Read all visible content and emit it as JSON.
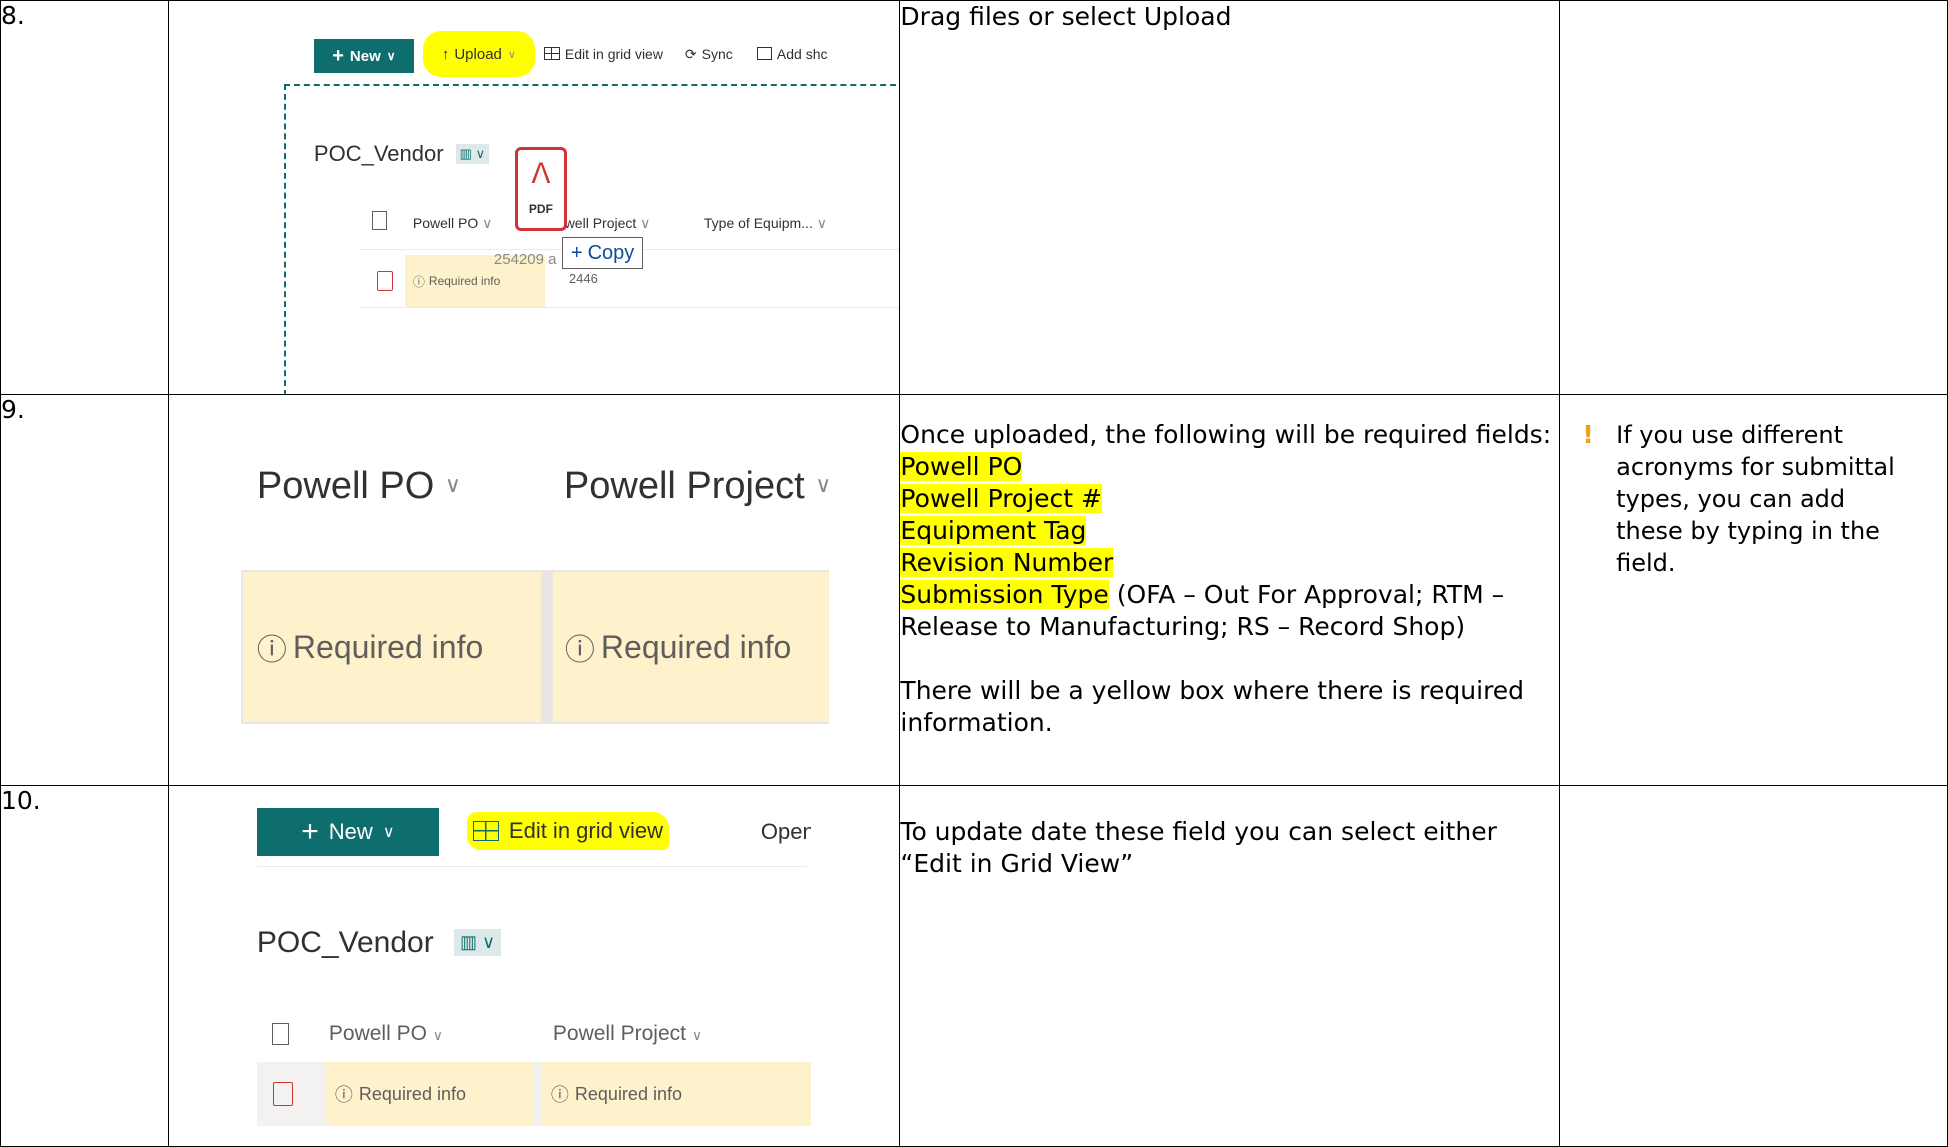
{
  "rows": [
    {
      "number": "8.",
      "description": "Drag files or select Upload",
      "note": "",
      "screenshot": {
        "new_label": "New",
        "upload_label": "Upload",
        "edit_grid_label": "Edit in grid view",
        "sync_label": "Sync",
        "add_shortcut_label": "Add shc",
        "library_title": "POC_Vendor",
        "columns": [
          "Powell PO",
          "owell Project",
          "Type of Equipm..."
        ],
        "pdf_label": "PDF",
        "copy_label": "Copy",
        "file_fragment": "254209 a",
        "row_value": "2446",
        "required_label": "Required info"
      }
    },
    {
      "number": "9.",
      "description_intro": "Once uploaded, the following will be required fields:",
      "required_fields": [
        "Powell PO",
        "Powell Project #",
        "Equipment Tag",
        "Revision Number",
        "Submission Type"
      ],
      "submission_types": " (OFA – Out For Approval; RTM – Release to Manufacturing; RS – Record Shop)",
      "description_outro": "There will be a yellow box where there is required information.",
      "note": "If you use different acronyms for submittal types, you can add these by typing in the field.",
      "note_marker": "!",
      "screenshot": {
        "columns": [
          "Powell PO",
          "Powell Project"
        ],
        "required_label": "Required info"
      }
    },
    {
      "number": "10.",
      "description": "To update date these field you can select either “Edit in Grid View”",
      "note": "",
      "screenshot": {
        "new_label": "New",
        "edit_grid_label": "Edit in grid view",
        "open_label": "Open",
        "library_title": "POC_Vendor",
        "columns": [
          "Powell PO",
          "Powell Project"
        ],
        "required_label": "Required info"
      }
    }
  ],
  "colors": {
    "highlight": "#ffff00",
    "required_bg": "#fdf2cc",
    "brand_teal": "#0e6e6e",
    "pdf_red": "#d13438",
    "note_marker": "#e8a317"
  }
}
